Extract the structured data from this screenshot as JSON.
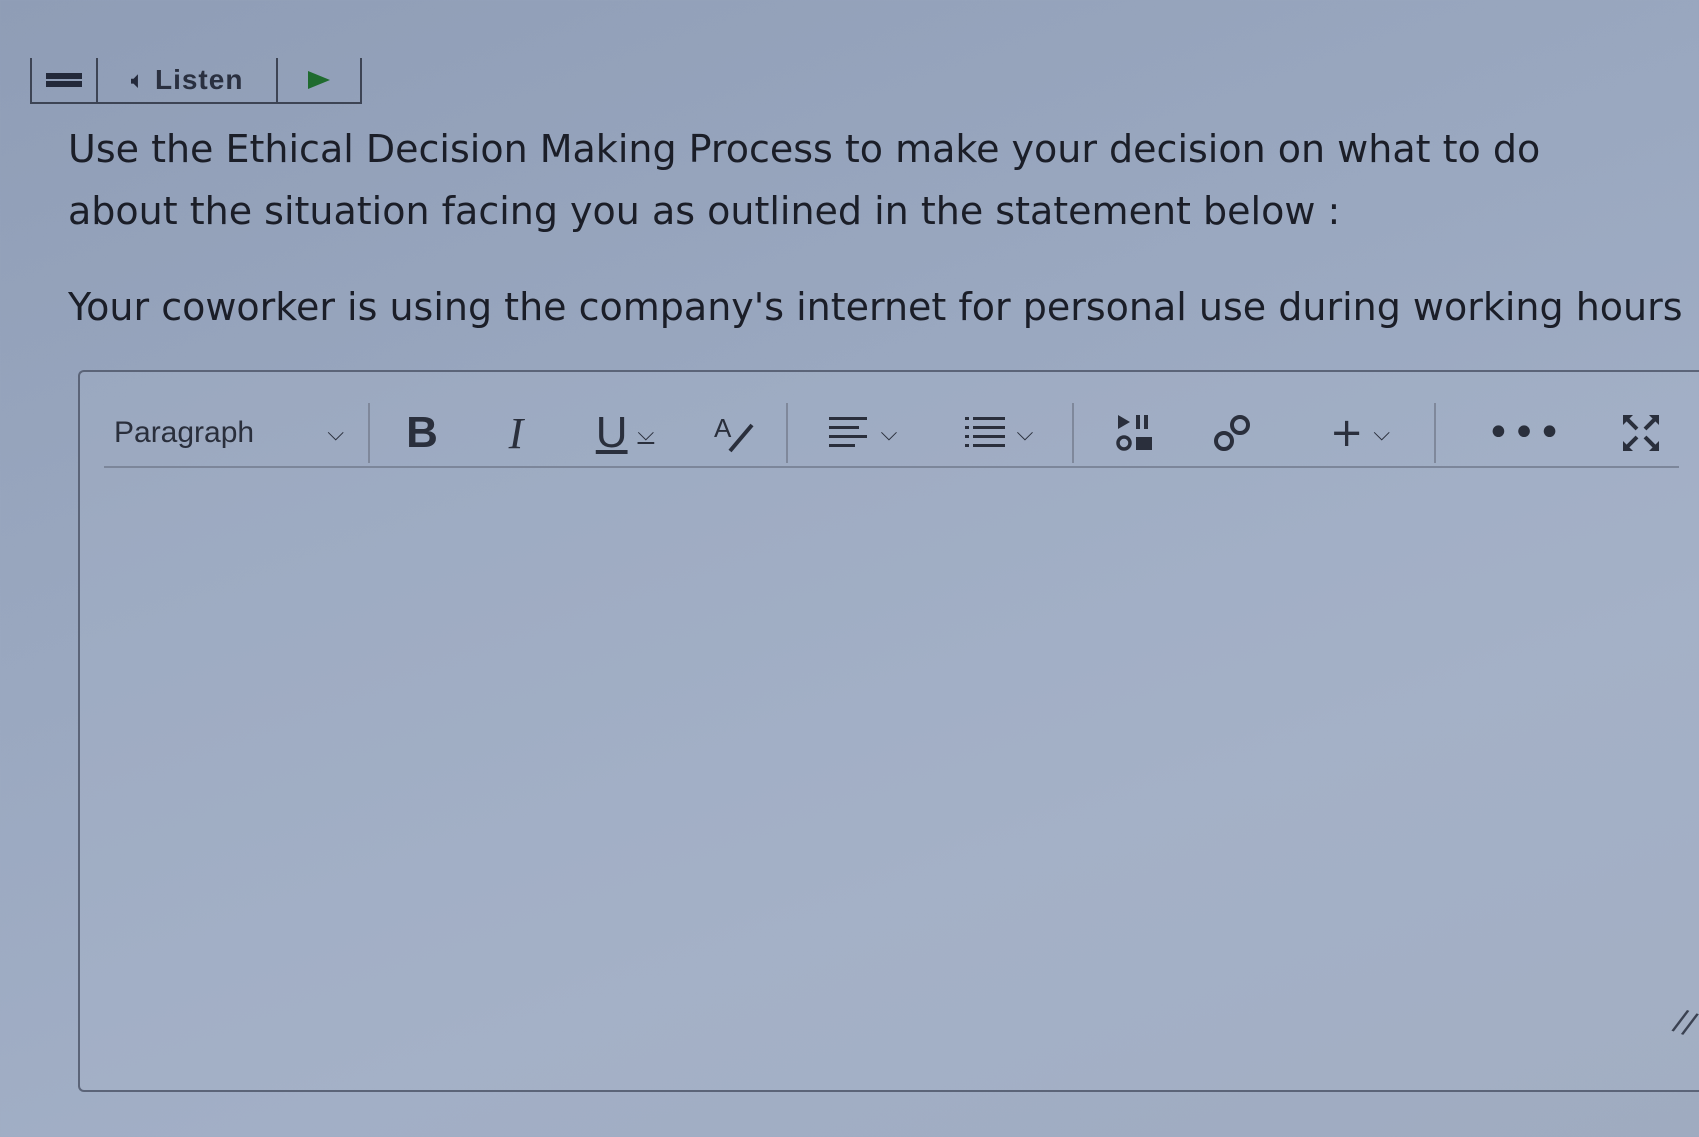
{
  "listen_bar": {
    "listen_label": "Listen"
  },
  "question": {
    "prompt": "Use the Ethical Decision Making Process to make your decision on what to do about the situation facing you as outlined in the statement below :",
    "statement": "Your coworker is using the company's internet for personal use during working hours"
  },
  "editor": {
    "toolbar": {
      "paragraph_label": "Paragraph",
      "bold_label": "B",
      "italic_label": "I",
      "underline_label": "U",
      "icons": [
        "chevron-down-icon",
        "spellcheck-icon",
        "align-left-icon",
        "list-icon",
        "media-icon",
        "link-icon",
        "plus-icon",
        "more-icon",
        "fullscreen-icon"
      ]
    },
    "content": ""
  },
  "colors": {
    "background": "#9aa8c0",
    "text": "#1b1e28",
    "play": "#1f6b2f"
  }
}
